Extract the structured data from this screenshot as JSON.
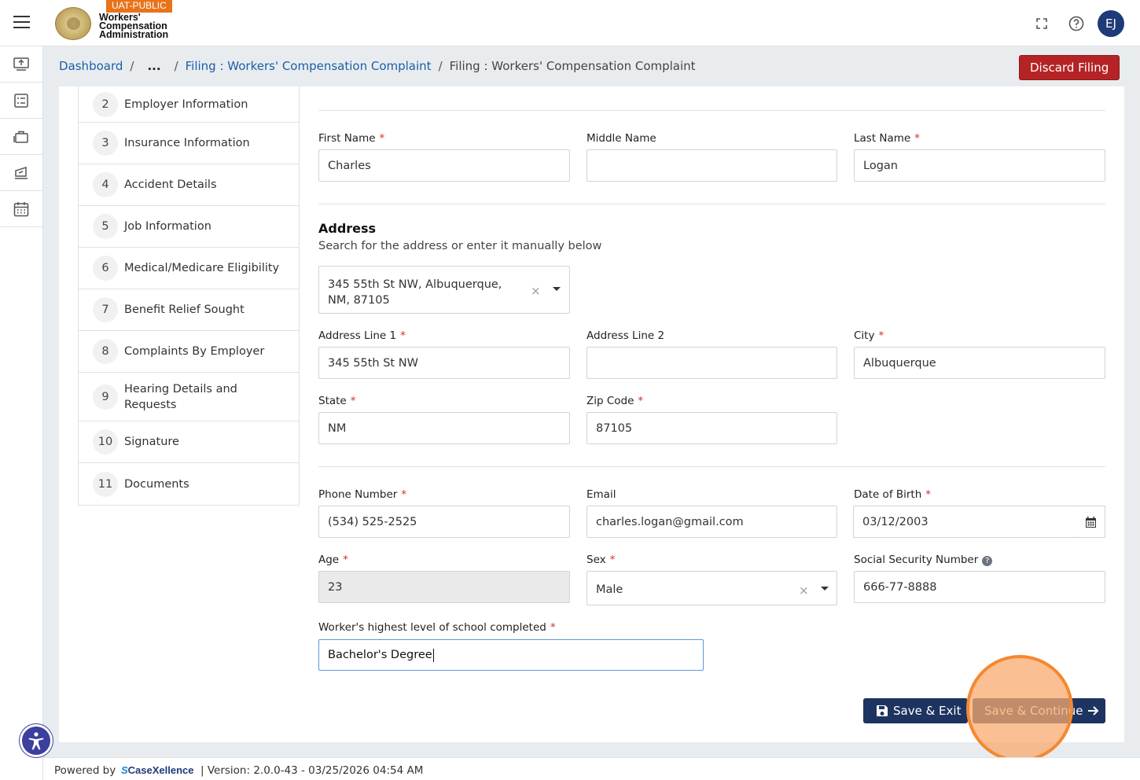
{
  "header": {
    "badge": "UAT-PUBLIC",
    "brand_line1": "Workers'",
    "brand_line2": "Compensation",
    "brand_line3": "Administration",
    "user_initials": "EJ",
    "icons": [
      "menu-icon",
      "fullscreen-icon",
      "help-icon"
    ]
  },
  "rail": {
    "items": [
      "upload-icon",
      "checklist-icon",
      "briefcase-icon",
      "gavel-icon",
      "calendar-icon"
    ]
  },
  "breadcrumb": {
    "dashboard": "Dashboard",
    "ellipsis": "...",
    "parent": "Filing : Workers' Compensation Complaint",
    "current": "Filing : Workers' Compensation Complaint",
    "discard_label": "Discard Filing"
  },
  "steps": [
    {
      "num": "2",
      "label": "Employer Information"
    },
    {
      "num": "3",
      "label": "Insurance Information"
    },
    {
      "num": "4",
      "label": "Accident Details"
    },
    {
      "num": "5",
      "label": "Job Information"
    },
    {
      "num": "6",
      "label": "Medical/Medicare Eligibility"
    },
    {
      "num": "7",
      "label": "Benefit Relief Sought"
    },
    {
      "num": "8",
      "label": "Complaints By Employer"
    },
    {
      "num": "9",
      "label": "Hearing Details and Requests"
    },
    {
      "num": "10",
      "label": "Signature"
    },
    {
      "num": "11",
      "label": "Documents"
    }
  ],
  "form": {
    "first_name": {
      "label": "First Name",
      "value": "Charles"
    },
    "middle_name": {
      "label": "Middle Name",
      "value": ""
    },
    "last_name": {
      "label": "Last Name",
      "value": "Logan"
    },
    "address_title": "Address",
    "address_subtitle": "Search for the address or enter it manually below",
    "address_search_value": "345 55th St NW, Albuquerque, NM, 87105",
    "address_line1": {
      "label": "Address Line 1",
      "value": "345 55th St NW"
    },
    "address_line2": {
      "label": "Address Line 2",
      "value": ""
    },
    "city": {
      "label": "City",
      "value": "Albuquerque"
    },
    "state": {
      "label": "State",
      "value": "NM"
    },
    "zip": {
      "label": "Zip Code",
      "value": "87105"
    },
    "phone": {
      "label": "Phone Number",
      "value": "(534) 525-2525"
    },
    "email": {
      "label": "Email",
      "value": "charles.logan@gmail.com"
    },
    "dob": {
      "label": "Date of Birth",
      "value": "03/12/2003"
    },
    "age": {
      "label": "Age",
      "value": "23"
    },
    "sex": {
      "label": "Sex",
      "value": "Male"
    },
    "ssn": {
      "label": "Social Security Number",
      "value": "666-77-8888"
    },
    "school": {
      "label": "Worker's highest level of school completed",
      "value": "Bachelor's Degree"
    },
    "required_mark": "*",
    "help_glyph": "?",
    "clear_glyph": "×"
  },
  "actions": {
    "save_exit": "Save & Exit",
    "save_continue": "Save & Continue"
  },
  "footer": {
    "powered_by": "Powered by",
    "logo_s": "S",
    "logo_text": "CaseXellence",
    "version": "|  Version: 2.0.0-43 - 03/25/2026 04:54 AM"
  },
  "colors": {
    "primary": "#1d3461",
    "danger": "#b52325",
    "link": "#1a5fa8",
    "badge": "#e8731a",
    "highlight": "#f5882f"
  }
}
